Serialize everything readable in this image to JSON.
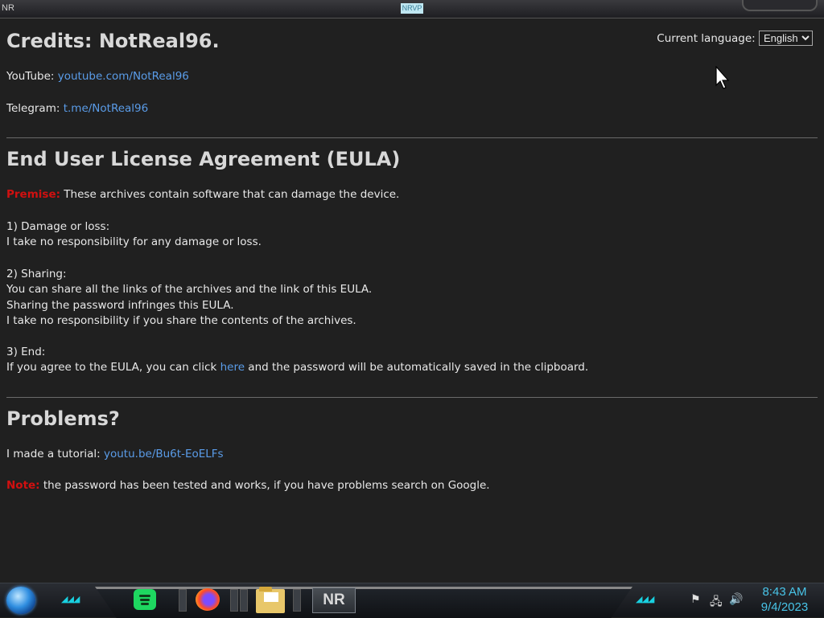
{
  "window": {
    "app_label": "NR",
    "badge": "NRVP"
  },
  "credits": {
    "title": "Credits: NotReal96.",
    "youtube_label": "YouTube:",
    "youtube_link": "youtube.com/NotReal96",
    "telegram_label": "Telegram:",
    "telegram_link": "t.me/NotReal96"
  },
  "language": {
    "label": "Current language:",
    "selected": "English"
  },
  "eula": {
    "title": "End User License Agreement (EULA)",
    "premise_label": "Premise:",
    "premise_text": "These archives contain software that can damage the device.",
    "s1_title": "1) Damage or loss:",
    "s1_text": "I take no responsibility for any damage or loss.",
    "s2_title": "2) Sharing:",
    "s2_line1": "You can share all the links of the archives and the link of this EULA.",
    "s2_line2": "Sharing the password infringes this EULA.",
    "s2_line3": "I take no responsibility if you share the contents of the archives.",
    "s3_title": "3) End:",
    "s3_before": "If you agree to the EULA, you can click",
    "s3_link": "here",
    "s3_after": "and the password will be automatically saved in the clipboard."
  },
  "problems": {
    "title": "Problems?",
    "tutorial_label": "I made a tutorial:",
    "tutorial_link": "youtu.be/Bu6t-EoELFs",
    "note_label": "Note:",
    "note_text": "the password has been tested and works, if you have problems search on Google."
  },
  "taskbar": {
    "nr_button": "NR",
    "time": "8:43 AM",
    "date": "9/4/2023",
    "icons": [
      "start-orb-icon",
      "spotify-icon",
      "firefox-icon",
      "file-explorer-icon",
      "flag-icon",
      "network-icon",
      "volume-icon"
    ]
  },
  "colors": {
    "background": "#202020",
    "link": "#5a9ce8",
    "warning": "#d01010",
    "clock": "#48c4e8"
  }
}
